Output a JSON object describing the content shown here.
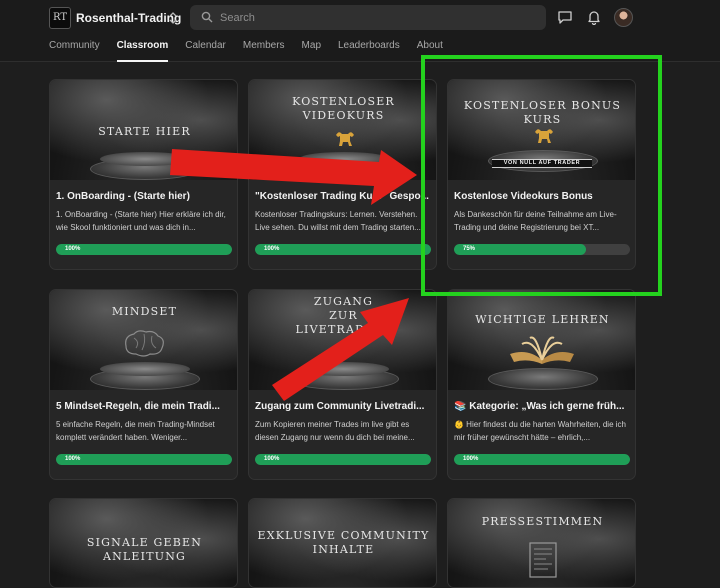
{
  "header": {
    "logo_text": "RT",
    "group_name": "Rosenthal-Trading",
    "search_placeholder": "Search"
  },
  "tabs": [
    {
      "label": "Community"
    },
    {
      "label": "Classroom",
      "active": true
    },
    {
      "label": "Calendar"
    },
    {
      "label": "Members"
    },
    {
      "label": "Map"
    },
    {
      "label": "Leaderboards"
    },
    {
      "label": "About"
    }
  ],
  "colors": {
    "progress_green": "#1f9e57",
    "annotation_green": "#24d21e",
    "annotation_red": "#e3201b"
  },
  "courses": [
    {
      "thumb_title": "STARTE HIER",
      "title": "1. OnBoarding - (Starte hier)",
      "description": "1. OnBoarding - (Starte hier) Hier erkläre ich dir, wie Skool funktioniert und was dich in...",
      "progress": 1.0,
      "progress_label": "100%"
    },
    {
      "thumb_title": "KOSTENLOSER\nVIDEOKURS",
      "title": "\"Kostenloser Trading Kurs\" Gespo...",
      "description": "Kostenloser Tradingskurs: Lernen. Verstehen. Live sehen. Du willst mit dem Trading starten...",
      "progress": 1.0,
      "progress_label": "100%",
      "icon": "bull-icon"
    },
    {
      "thumb_title": "KOSTENLOSER BONUS\nKURS",
      "ribbon": "VON NULL AUF TRADER",
      "title": "Kostenlose Videokurs Bonus",
      "description": "Als Dankeschön für deine Teilnahme am Live-Trading und deine Registrierung bei XT...",
      "progress": 0.75,
      "progress_label": "75%",
      "icon": "bull-icon"
    },
    {
      "thumb_title": "MINDSET",
      "title": "5 Mindset-Regeln, die mein Tradi...",
      "description": "5 einfache Regeln, die mein Trading-Mindset komplett verändert haben. Weniger...",
      "progress": 1.0,
      "progress_label": "100%",
      "icon": "brain-icon"
    },
    {
      "thumb_title": "ZUGANG\nZUR\nLIVETRADING",
      "title": "Zugang zum Community Livetradi...",
      "description": "Zum Kopieren meiner Trades im live gibt es diesen Zugang nur wenn du dich bei meine...",
      "progress": 1.0,
      "progress_label": "100%"
    },
    {
      "thumb_title": "WICHTIGE LEHREN",
      "title": "📚 Kategorie: „Was ich gerne früh...",
      "description": "👶 Hier findest du die harten Wahrheiten, die ich mir früher gewünscht hätte – ehrlich,...",
      "progress": 1.0,
      "progress_label": "100%",
      "icon": "book-icon"
    },
    {
      "thumb_title": "SIGNALE GEBEN\nANLEITUNG",
      "title": "",
      "description": "",
      "progress": null,
      "progress_label": ""
    },
    {
      "thumb_title": "EXKLUSIVE COMMUNITY\nINHALTE",
      "title": "",
      "description": "",
      "progress": null,
      "progress_label": ""
    },
    {
      "thumb_title": "PRESSESTIMMEN",
      "title": "",
      "description": "",
      "progress": null,
      "progress_label": "",
      "icon": "newspaper-icon"
    }
  ]
}
